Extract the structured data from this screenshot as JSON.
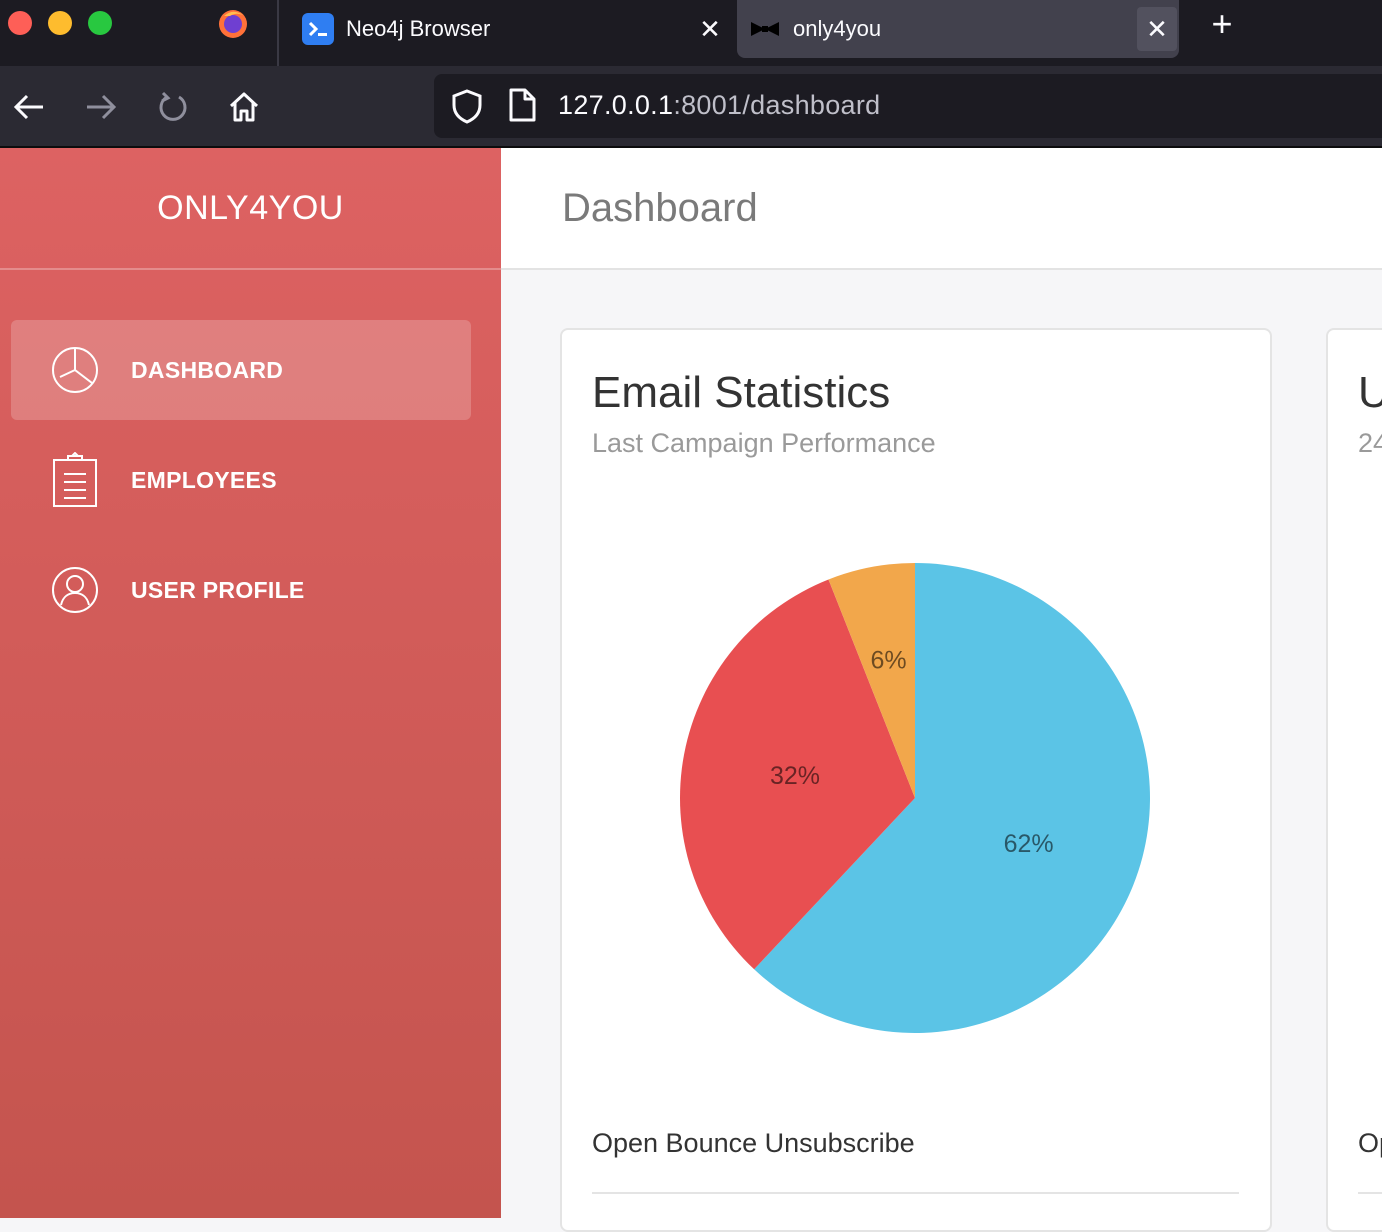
{
  "browser": {
    "tabs": [
      {
        "label": "Neo4j Browser",
        "icon": "neo4j-terminal-icon"
      },
      {
        "label": "only4you",
        "icon": "bowtie-icon",
        "active": true
      }
    ],
    "url": {
      "host": "127.0.0.1",
      "rest": ":8001/dashboard"
    }
  },
  "sidebar": {
    "brand": "ONLY4YOU",
    "items": [
      {
        "label": "DASHBOARD",
        "icon": "pie-chart-icon",
        "active": true
      },
      {
        "label": "EMPLOYEES",
        "icon": "clipboard-icon"
      },
      {
        "label": "USER PROFILE",
        "icon": "user-icon"
      }
    ]
  },
  "header": {
    "title": "Dashboard"
  },
  "email_card": {
    "title": "Email Statistics",
    "subtitle": "Last Campaign Performance",
    "legend": "Open Bounce Unsubscribe"
  },
  "second_card": {
    "title_fragment": "U",
    "subtitle_fragment": "24",
    "legend_fragment": "Op"
  },
  "colors": {
    "open": "#5bc4e6",
    "bounce": "#e84f51",
    "unsubscribe": "#f2a74b",
    "sidebar": "#d85e5e"
  },
  "chart_data": {
    "type": "pie",
    "categories": [
      "Open",
      "Bounce",
      "Unsubscribe"
    ],
    "values": [
      62,
      32,
      6
    ],
    "labels": [
      "62%",
      "32%",
      "6%"
    ]
  }
}
